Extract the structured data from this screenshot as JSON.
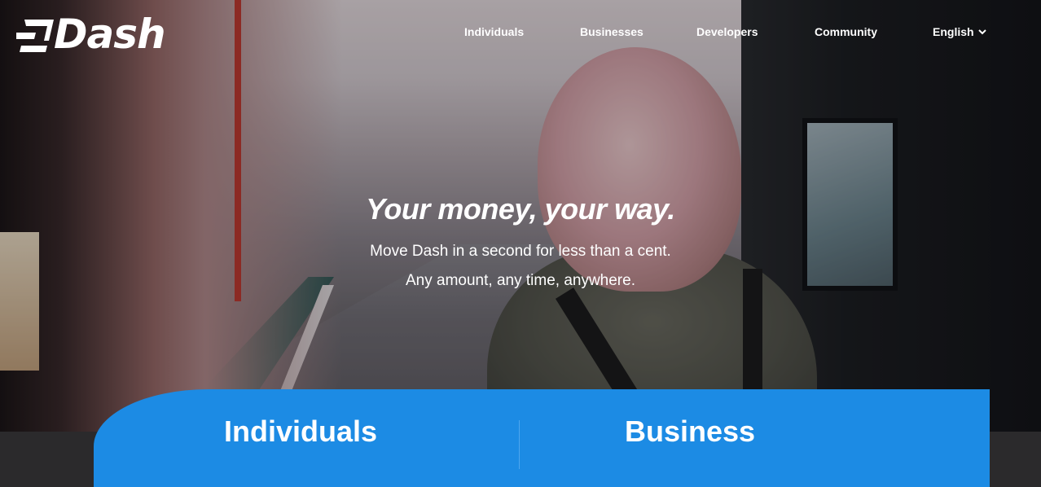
{
  "brand": {
    "name": "Dash",
    "color": "#ffffff",
    "accent": "#1c8be4"
  },
  "nav": {
    "items": [
      {
        "label": "Individuals"
      },
      {
        "label": "Businesses"
      },
      {
        "label": "Developers"
      },
      {
        "label": "Community"
      }
    ],
    "language": {
      "label": "English",
      "icon": "chevron-down-icon"
    }
  },
  "hero": {
    "headline": "Your money, your way.",
    "subline_1": "Move Dash in a second for less than a cent.",
    "subline_2": "Any amount, any time, anywhere."
  },
  "card": {
    "left_heading": "Individuals",
    "right_heading": "Business"
  }
}
